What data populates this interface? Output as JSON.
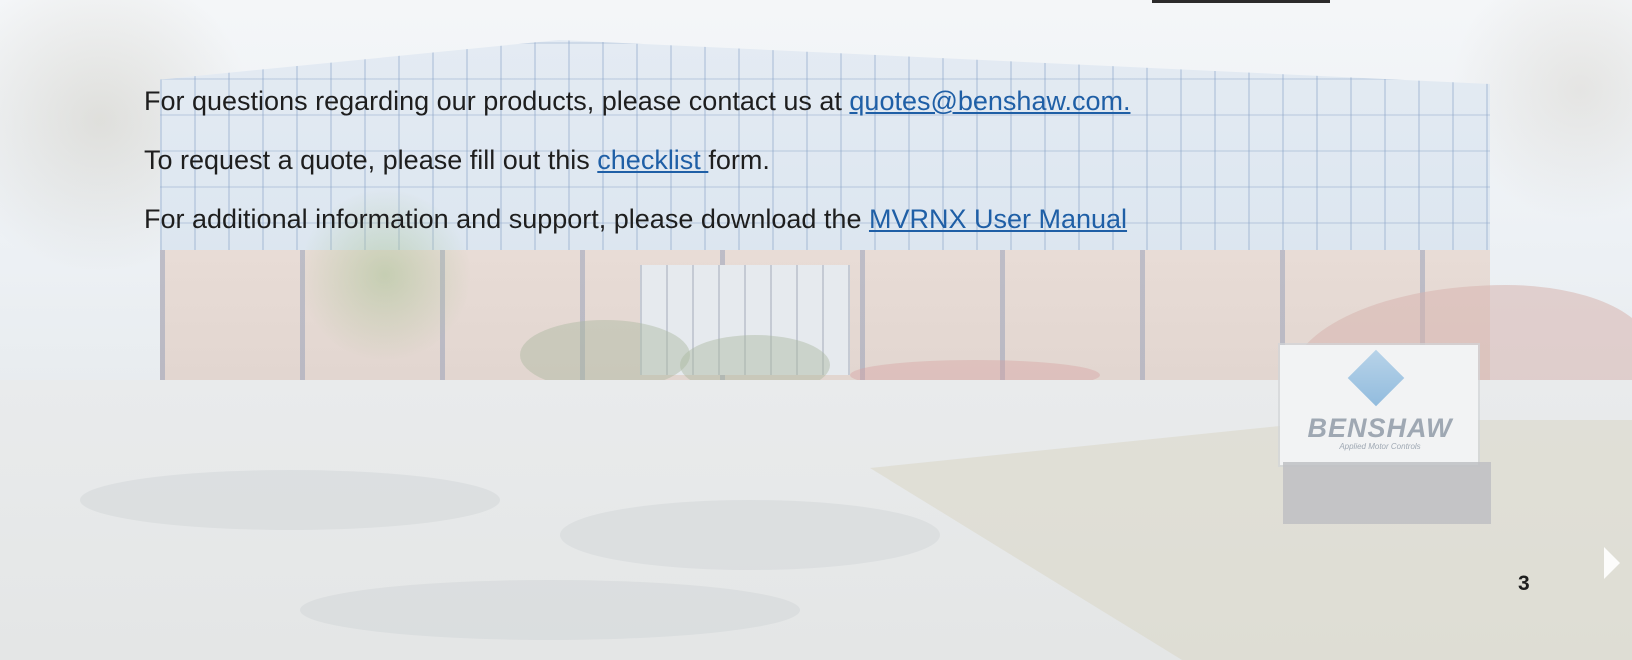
{
  "lines": {
    "contact_prefix": "For questions regarding our products, please contact us at ",
    "contact_link": "quotes@benshaw.com.",
    "quote_prefix": "To request a quote, please fill out this ",
    "quote_link": "checklist ",
    "quote_suffix": "form.",
    "support_prefix": "For additional information and support, please download the ",
    "support_link": "MVRNX User Manual "
  },
  "sign": {
    "brand": "BENSHAW",
    "tagline": "Applied Motor Controls"
  },
  "page_number": "3",
  "icons": {
    "next": "next-arrow-icon",
    "logo": "benshaw-logo-mark-icon"
  },
  "colors": {
    "text": "#1e1e1e",
    "link": "#1f5fa6"
  }
}
